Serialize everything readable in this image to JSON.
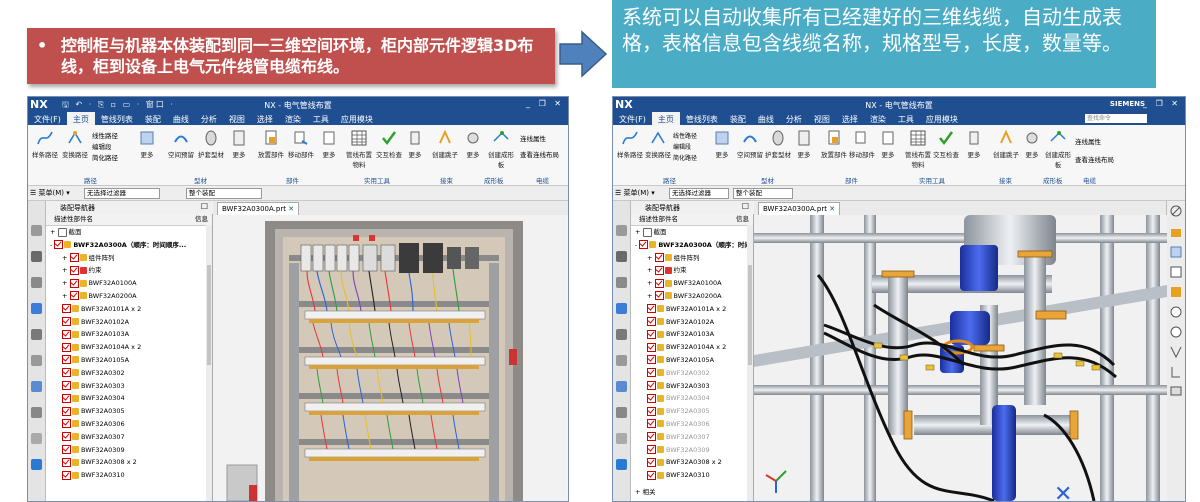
{
  "left_callout": {
    "bullet": "•",
    "text": "控制柜与机器本体装配到同一三维空间环境，柜内部元件逻辑3D布线，柜到设备上电气元件线管电缆布线。"
  },
  "right_callout": {
    "text": "系统可以自动收集所有已经建好的三维线缆，自动生成表格，表格信息包含线缆名称，规格型号，长度，数量等。"
  },
  "left_window": {
    "logo": "NX",
    "quick_access": "🖫 ↶ · ⎘ ▫ ▭ · 窗口 ·",
    "title": "NX - 电气管线布置",
    "window_controls": "_ ❐ ✕",
    "menu": [
      "文件(F)",
      "主页",
      "管线列表",
      "装配",
      "曲线",
      "分析",
      "视图",
      "选择",
      "渲染",
      "工具",
      "应用模块"
    ],
    "active_menu": 1,
    "ribbon": {
      "path_group": [
        "样条路径",
        "变换路径",
        "线性路径",
        "编辑段",
        "简化路径",
        "更多"
      ],
      "part_group": [
        "空间预留",
        "护套型材",
        "更多"
      ],
      "assembly_group": [
        "放置部件",
        "移动部件",
        "更多"
      ],
      "tools_group": [
        "管线布置物料",
        "交互检查",
        "更多"
      ],
      "connect_group": [
        "创建跳子",
        "更多"
      ],
      "harness_group": [
        "创建成形板",
        "更多"
      ],
      "electric_group": [
        "连线属性",
        "查看连线布局"
      ],
      "group_labels": [
        "路径",
        "型材",
        "部件",
        "实用工具",
        "接束",
        "成形板",
        "电缆"
      ]
    },
    "toolbar": {
      "menu": "☰ 菜单(M) ▾",
      "filter": "无选择过滤器",
      "scope": "整个装配"
    },
    "nav_title": "装配导航器",
    "nav_col_name": "描述性部件名",
    "nav_col_info": "信息",
    "tab_label": "BWF32A0300A.prt",
    "tree": [
      "截面",
      "BWF32A0300A（顺序：时间顺序...",
      "组件阵列",
      "约束",
      "BWF32A0100A",
      "BWF32A0200A",
      "BWF32A0101A x 2",
      "BWF32A0102A",
      "BWF32A0103A",
      "BWF32A0104A x 2",
      "BWF32A0105A",
      "BWF32A0302",
      "BWF32A0303",
      "BWF32A0304",
      "BWF32A0305",
      "BWF32A0306",
      "BWF32A0307",
      "BWF32A0309",
      "BWF32A0308 x 2",
      "BWF32A0310"
    ]
  },
  "right_window": {
    "logo": "NX",
    "title": "NX - 电气管线布置",
    "brand": "SIEMENS",
    "window_controls": "_ ❐ ✕",
    "search_placeholder": "查找命令",
    "menu": [
      "文件(F)",
      "主页",
      "管线列表",
      "装配",
      "曲线",
      "分析",
      "视图",
      "选择",
      "渲染",
      "工具",
      "应用模块"
    ],
    "active_menu": 1,
    "toolbar": {
      "menu": "☰ 菜单(M) ▾",
      "filter": "无选择过滤器",
      "scope": "整个装配"
    },
    "nav_title": "装配导航器",
    "nav_col_name": "描述性部件名",
    "nav_col_info": "信息",
    "tab_label": "BWF32A0300A.prt",
    "bottom_item": "相关",
    "tree": [
      "截面",
      "BWF32A0300A（顺序：时间顺序...",
      "组件阵列",
      "约束",
      "BWF32A0100A",
      "BWF32A0200A",
      "BWF32A0101A x 2",
      "BWF32A0102A",
      "BWF32A0103A",
      "BWF32A0104A x 2",
      "BWF32A0105A",
      "BWF32A0302",
      "BWF32A0303",
      "BWF32A0304",
      "BWF32A0305",
      "BWF32A0306",
      "BWF32A0307",
      "BWF32A0309",
      "BWF32A0308 x 2",
      "BWF32A0310"
    ]
  },
  "colors": {
    "nx_blue": "#1f4f91",
    "red_callout": "#c0504d",
    "teal_callout": "#4bacc6",
    "arrow": "#4f81bd"
  }
}
